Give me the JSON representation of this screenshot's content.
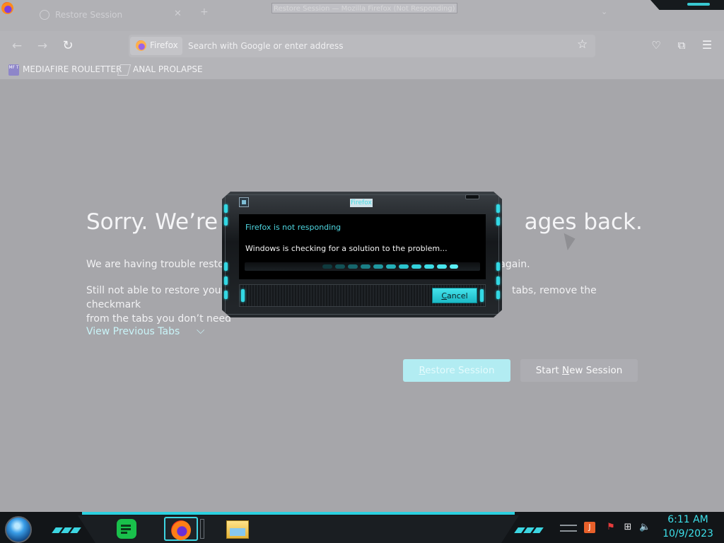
{
  "window": {
    "title": "Restore Session — Mozilla Firefox (Not Responding)",
    "tab_title": "Restore Session"
  },
  "navbar": {
    "identity_label": "Firefox",
    "url_placeholder": "Search with Google or enter address"
  },
  "bookmarks": [
    {
      "icon_text": "MF\nT",
      "label": "MEDIAFIRE ROULETTER"
    },
    {
      "label": "ANAL PROLAPSE"
    }
  ],
  "page": {
    "headline_left": "Sorry. We’re h",
    "headline_right": "ages back.",
    "para1_left": "We are having trouble restori",
    "para1_right": "again.",
    "para2_left_line1": "Still not able to restore your s",
    "para2_right_line1": "tabs, remove the checkmark",
    "para2_left_line2": "from the tabs you don’t need",
    "view_previous_tabs": "View Previous Tabs",
    "restore_button_first": "R",
    "restore_button_rest": "estore Session",
    "new_session_before": "Start ",
    "new_session_underlined": "N",
    "new_session_after": "ew Session"
  },
  "dialog": {
    "title": "Firefox",
    "heading": "Firefox is not responding",
    "message": "Windows is checking for a solution to the problem...",
    "cancel_first": "C",
    "cancel_rest": "ancel"
  },
  "taskbar": {
    "time": "6:11 AM",
    "date": "10/9/2023"
  },
  "colors": {
    "accent": "#3de0ea",
    "content_dim": "#a6a6aa",
    "restore_button": "#b2ecf2"
  }
}
